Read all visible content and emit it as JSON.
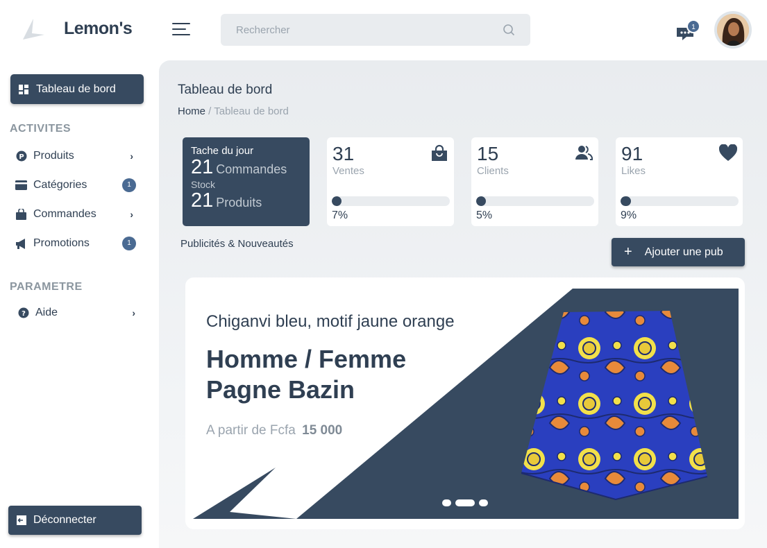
{
  "header": {
    "brand": "Lemon's",
    "search_placeholder": "Rechercher",
    "messages_count": "1"
  },
  "sidebar": {
    "active_item": "Tableau de bord",
    "section_activites": "ACTIVITES",
    "items": [
      {
        "label": "Produits",
        "icon": "p-circle-icon",
        "indicator": "›"
      },
      {
        "label": "Catégories",
        "icon": "card-icon",
        "badge": "1"
      },
      {
        "label": "Commandes",
        "icon": "bag-icon",
        "indicator": "›"
      },
      {
        "label": "Promotions",
        "icon": "megaphone-icon",
        "badge": "1"
      }
    ],
    "section_parametre": "PARAMETRE",
    "help": {
      "label": "Aide",
      "icon": "question-icon",
      "indicator": "›"
    },
    "logout_label": "Déconnecter"
  },
  "main": {
    "title": "Tableau de bord",
    "breadcrumb_home": "Home",
    "breadcrumb_sep": " / ",
    "breadcrumb_current": "Tableau de bord",
    "task": {
      "title": "Tache du jour",
      "orders_count": "21",
      "orders_label": "Commandes",
      "stock_label": "Stock",
      "products_count": "21",
      "products_label": "Produits"
    },
    "stats": [
      {
        "value": "31",
        "label": "Ventes",
        "percent": "7%",
        "icon": "shopping-bag-icon",
        "progress": 0.07
      },
      {
        "value": "15",
        "label": "Clients",
        "percent": "5%",
        "icon": "users-icon",
        "progress": 0.05
      },
      {
        "value": "91",
        "label": "Likes",
        "percent": "9%",
        "icon": "heart-icon",
        "progress": 0.09
      }
    ],
    "pub_title": "Publicités & Nouveautés",
    "add_pub_label": "Ajouter une pub",
    "banner": {
      "subtitle": "Chiganvi bleu, motif jaune orange",
      "title_line1": "Homme / Femme",
      "title_line2": "Pagne Bazin",
      "price_prefix": "A partir de Fcfa",
      "price_value": "15 000",
      "slide_count": 3,
      "active_slide": 2
    }
  },
  "colors": {
    "primary": "#374a60",
    "badge": "#4a6a92",
    "muted": "#9aa4ae",
    "background": "#e9ecef"
  }
}
